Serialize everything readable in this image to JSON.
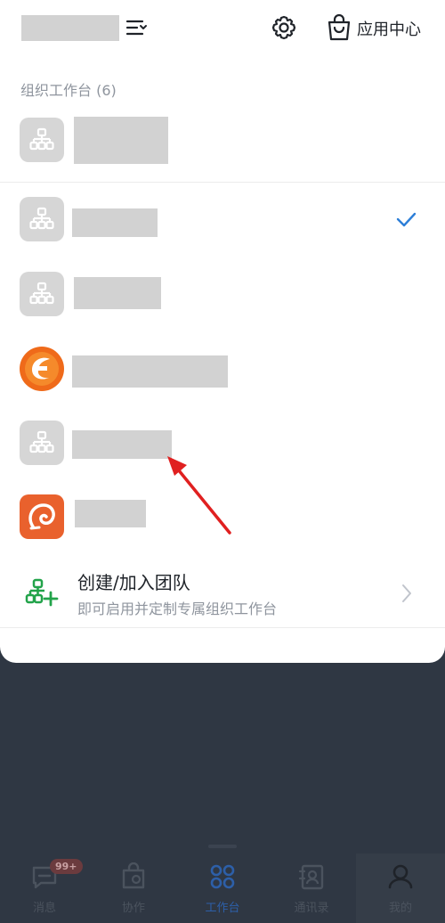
{
  "header": {
    "app_center_label": "应用中心"
  },
  "section": {
    "label": "组织工作台 (6)"
  },
  "organizations": [
    {
      "logo": "org-tree-icon",
      "selected": false
    },
    {
      "logo": "org-tree-icon",
      "selected": true
    },
    {
      "logo": "org-tree-icon",
      "selected": false
    },
    {
      "logo": "orange-brand-logo",
      "selected": false
    },
    {
      "logo": "org-tree-icon",
      "selected": false
    },
    {
      "logo": "orange-swirl-logo",
      "selected": false
    }
  ],
  "create_team": {
    "title": "创建/加入团队",
    "subtitle": "即可启用并定制专属组织工作台"
  },
  "tabbar": {
    "tabs": [
      {
        "label": "消息",
        "badge": "99+"
      },
      {
        "label": "协作"
      },
      {
        "label": "工作台"
      },
      {
        "label": "通讯录"
      },
      {
        "label": "我的"
      }
    ]
  },
  "colors": {
    "accent_blue": "#2d7fd8",
    "green_icon": "#22a34a",
    "annotation_red": "#e02020",
    "logo_gray": "#d6d6d6"
  }
}
